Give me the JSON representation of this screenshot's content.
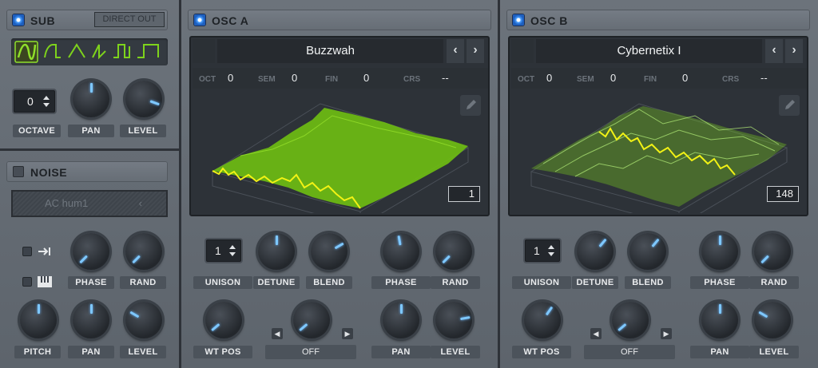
{
  "sub": {
    "title": "SUB",
    "direct_out": "DIRECT OUT",
    "waveforms": [
      "sine-wave-icon",
      "half-sine-icon",
      "triangle-wave-icon",
      "saw-wave-icon",
      "square-wave-icon",
      "pulse-wave-icon"
    ],
    "octave_value": "0",
    "labels": {
      "octave": "OCTAVE",
      "pan": "PAN",
      "level": "LEVEL"
    }
  },
  "noise": {
    "title": "NOISE",
    "preset": "AC hum1",
    "labels": {
      "phase": "PHASE",
      "rand": "RAND",
      "pitch": "PITCH",
      "pan": "PAN",
      "level": "LEVEL"
    }
  },
  "osc_a": {
    "title": "OSC A",
    "wavetable": "Buzzwah",
    "params": {
      "oct_label": "OCT",
      "oct": "0",
      "sem_label": "SEM",
      "sem": "0",
      "fin_label": "FIN",
      "fin": "0",
      "crs_label": "CRS",
      "crs": "--"
    },
    "frame": "1",
    "unison": "1",
    "labels": {
      "unison": "UNISON",
      "detune": "DETUNE",
      "blend": "BLEND",
      "phase": "PHASE",
      "rand": "RAND",
      "wt_pos": "WT POS",
      "warp": "OFF",
      "pan": "PAN",
      "level": "LEVEL"
    }
  },
  "osc_b": {
    "title": "OSC B",
    "wavetable": "Cybernetix I",
    "params": {
      "oct_label": "OCT",
      "oct": "0",
      "sem_label": "SEM",
      "sem": "0",
      "fin_label": "FIN",
      "fin": "0",
      "crs_label": "CRS",
      "crs": "--"
    },
    "frame": "148",
    "unison": "1",
    "labels": {
      "unison": "UNISON",
      "detune": "DETUNE",
      "blend": "BLEND",
      "phase": "PHASE",
      "rand": "RAND",
      "wt_pos": "WT POS",
      "warp": "OFF",
      "pan": "PAN",
      "level": "LEVEL"
    }
  },
  "colors": {
    "accent": "#4aa0ff",
    "wave_green": "#7ed31c",
    "wave_yellow": "#f2f215",
    "panel": "#656c74"
  }
}
